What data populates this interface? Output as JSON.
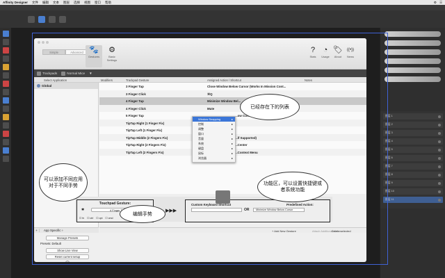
{
  "menubar": {
    "items": [
      "Affinity Designer",
      "文件",
      "编辑",
      "文本",
      "图层",
      "选择",
      "视图",
      "窗口",
      "帮助"
    ],
    "right": [
      "⚙",
      "☰"
    ]
  },
  "affinity": {
    "title": ""
  },
  "btt": {
    "segments": [
      "Simple",
      "Advanced"
    ],
    "top_icons": [
      {
        "glyph": "🐾",
        "label": "Gestures"
      },
      {
        "glyph": "⚙",
        "label": "Basic Settings"
      },
      {
        "glyph": "?",
        "label": "Stats"
      },
      {
        "glyph": "◔",
        "label": "Usage"
      },
      {
        "glyph": "🏷",
        "label": "About"
      },
      {
        "glyph": "((•))",
        "label": "News"
      }
    ],
    "tabs": [
      {
        "label": "Trackpads",
        "muted": false
      },
      {
        "label": "Normal Mice",
        "muted": false
      },
      {
        "label": "▼",
        "muted": false
      }
    ],
    "columns": {
      "select_app": "Select Application",
      "modifiers": "Modifiers",
      "gesture": "Trackpad Gesture",
      "action": "Assigned Action / Shortcut",
      "notes": "Notes"
    },
    "apps": [
      {
        "label": "Global"
      }
    ],
    "gestures": [
      {
        "gesture": "3 Finger Tap",
        "action": "Close Window Below Cursor (Works In Mission Cont...",
        "selected": false
      },
      {
        "gesture": "3 Finger Click",
        "action": "⌘Q",
        "selected": false
      },
      {
        "gesture": "4 Finger Tap",
        "action": "Minimize Window Bel...",
        "selected": true
      },
      {
        "gesture": "4 Finger Click",
        "action": "Mute",
        "selected": false
      },
      {
        "gesture": "5 Finger Tap",
        "action": "...ow Cursor",
        "selected": false
      },
      {
        "gesture": "TipTap Right (1 Finger Fix)",
        "action": "",
        "selected": false
      },
      {
        "gesture": "TipTap Left (1 Finger Fix)",
        "action": "",
        "selected": false
      },
      {
        "gesture": "TipTap Middle (2 Fingers Fix)",
        "action": "...lf Supported)",
        "selected": false
      },
      {
        "gesture": "TipTap Right (2 Fingers Fix)",
        "action": "...Center",
        "selected": false
      },
      {
        "gesture": "TipTap Left (2 Fingers Fix)",
        "action": "...Context Menu",
        "selected": false
      }
    ],
    "context_menu": [
      "Window Snapping",
      "控制",
      "调整",
      "窗口",
      "音量",
      "系统",
      "键盘",
      "鼠标",
      "浏览器"
    ],
    "left_bottom": {
      "plus": "+",
      "app_specific": "App Specific ÷"
    },
    "bottom_bar": {
      "add_new": "+ Add New Gesture",
      "attach_action": "Attach Additional Action",
      "delete": "Delete selected"
    },
    "presets": {
      "manage": "Manage Presets",
      "default": "Presets: Default",
      "show_live": "Show Live View",
      "reset": "Reset current setup",
      "help": "?"
    },
    "gesture_box": {
      "title": "Touchpad Gesture:",
      "selected": "4 Finger Tap",
      "modifiers": [
        "fn",
        "ctrl",
        "opt",
        "cmd"
      ]
    },
    "arrow": "▶▶▶",
    "action_box": {
      "custom_label": "Custom Keyboard Shortcut",
      "predefined_label": "Predefined Action:",
      "or": "OR",
      "predefined_value": "Minimize Window Below Cursor"
    }
  },
  "callouts": {
    "list_note": "已经存在下的列表",
    "app_note": "可以添加不同应用对于不同手势",
    "gesture_note": "编辑手势",
    "function_note": "功能区，可以设置快捷键或者系统功能"
  },
  "right_panel": {
    "layers": [
      "图层 1",
      "图层 2",
      "图层 3",
      "图层 4",
      "图层 5",
      "图层 6",
      "图层 7",
      "图层 8",
      "图层 9",
      "图层 10",
      "图层 11"
    ]
  }
}
